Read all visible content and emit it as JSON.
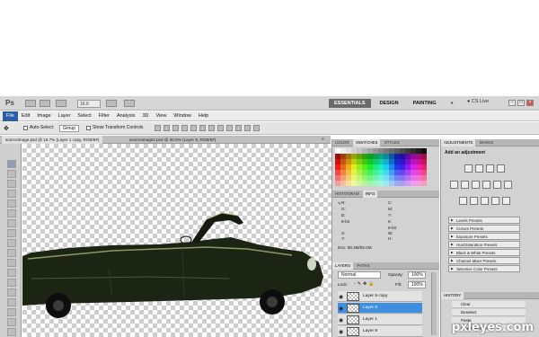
{
  "app": {
    "logo": "Ps",
    "zoom": "16.6"
  },
  "workspaces": [
    {
      "label": "ESSENTIALS",
      "active": true
    },
    {
      "label": "DESIGN",
      "active": false
    },
    {
      "label": "PAINTING",
      "active": false
    }
  ],
  "cs_live": "CS Live",
  "menu": [
    "File",
    "Edit",
    "Image",
    "Layer",
    "Select",
    "Filter",
    "Analysis",
    "3D",
    "View",
    "Window",
    "Help"
  ],
  "options": {
    "auto_select": "Auto-Select:",
    "auto_select_value": "Group",
    "show_transform": "Show Transform Controls"
  },
  "doc_tabs": [
    {
      "label": "sourceimage.psd @ 16.7% (Layer 1 copy, RGB/8#)",
      "active": true
    },
    {
      "label": "sourceimage2.psd @ 30.6% (Layer 9, RGB/8#)",
      "active": false
    }
  ],
  "panels": {
    "color_tabs": [
      "COLOR",
      "SWATCHES",
      "STYLES"
    ],
    "info_tabs": [
      "HISTOGRAM",
      "INFO"
    ],
    "info": {
      "r": "R:",
      "g": "G:",
      "b": "B:",
      "bits1": "8-bit",
      "c": "C:",
      "m": "M:",
      "y": "Y:",
      "k": "K:",
      "bits2": "8-bit",
      "x": "X:",
      "yy": "Y:",
      "w": "W:",
      "h": "H:",
      "doc": "Doc: 58.3M/56.0M"
    },
    "layers_tabs": [
      "LAYERS",
      "PATHS"
    ],
    "blend_mode": "Normal",
    "opacity_label": "Opacity:",
    "opacity_value": "100%",
    "lock_label": "Lock:",
    "fill_label": "Fill:",
    "fill_value": "100%",
    "layers": [
      {
        "name": "Layer 9 copy",
        "selected": false
      },
      {
        "name": "Layer 9",
        "selected": true
      },
      {
        "name": "Layer 1",
        "selected": false
      },
      {
        "name": "Layer 8",
        "selected": false
      }
    ],
    "adjust_tabs": [
      "ADJUSTMENTS",
      "MASKS"
    ],
    "add_adjustment": "Add an adjustment",
    "presets": [
      "Levels Presets",
      "Curves Presets",
      "Exposure Presets",
      "Hue/Saturation Presets",
      "Black & White Presets",
      "Channel Mixer Presets",
      "Selective Color Presets"
    ],
    "history_tab": "HISTORY",
    "history": [
      "Clear",
      "Deselect",
      "Paste",
      "Free Transform"
    ]
  },
  "watermark": "pxleyes.com",
  "colors": {
    "accent": "#3f8fe0",
    "menu_highlight": "#2a5ea8",
    "car_body": "#1c2414"
  }
}
